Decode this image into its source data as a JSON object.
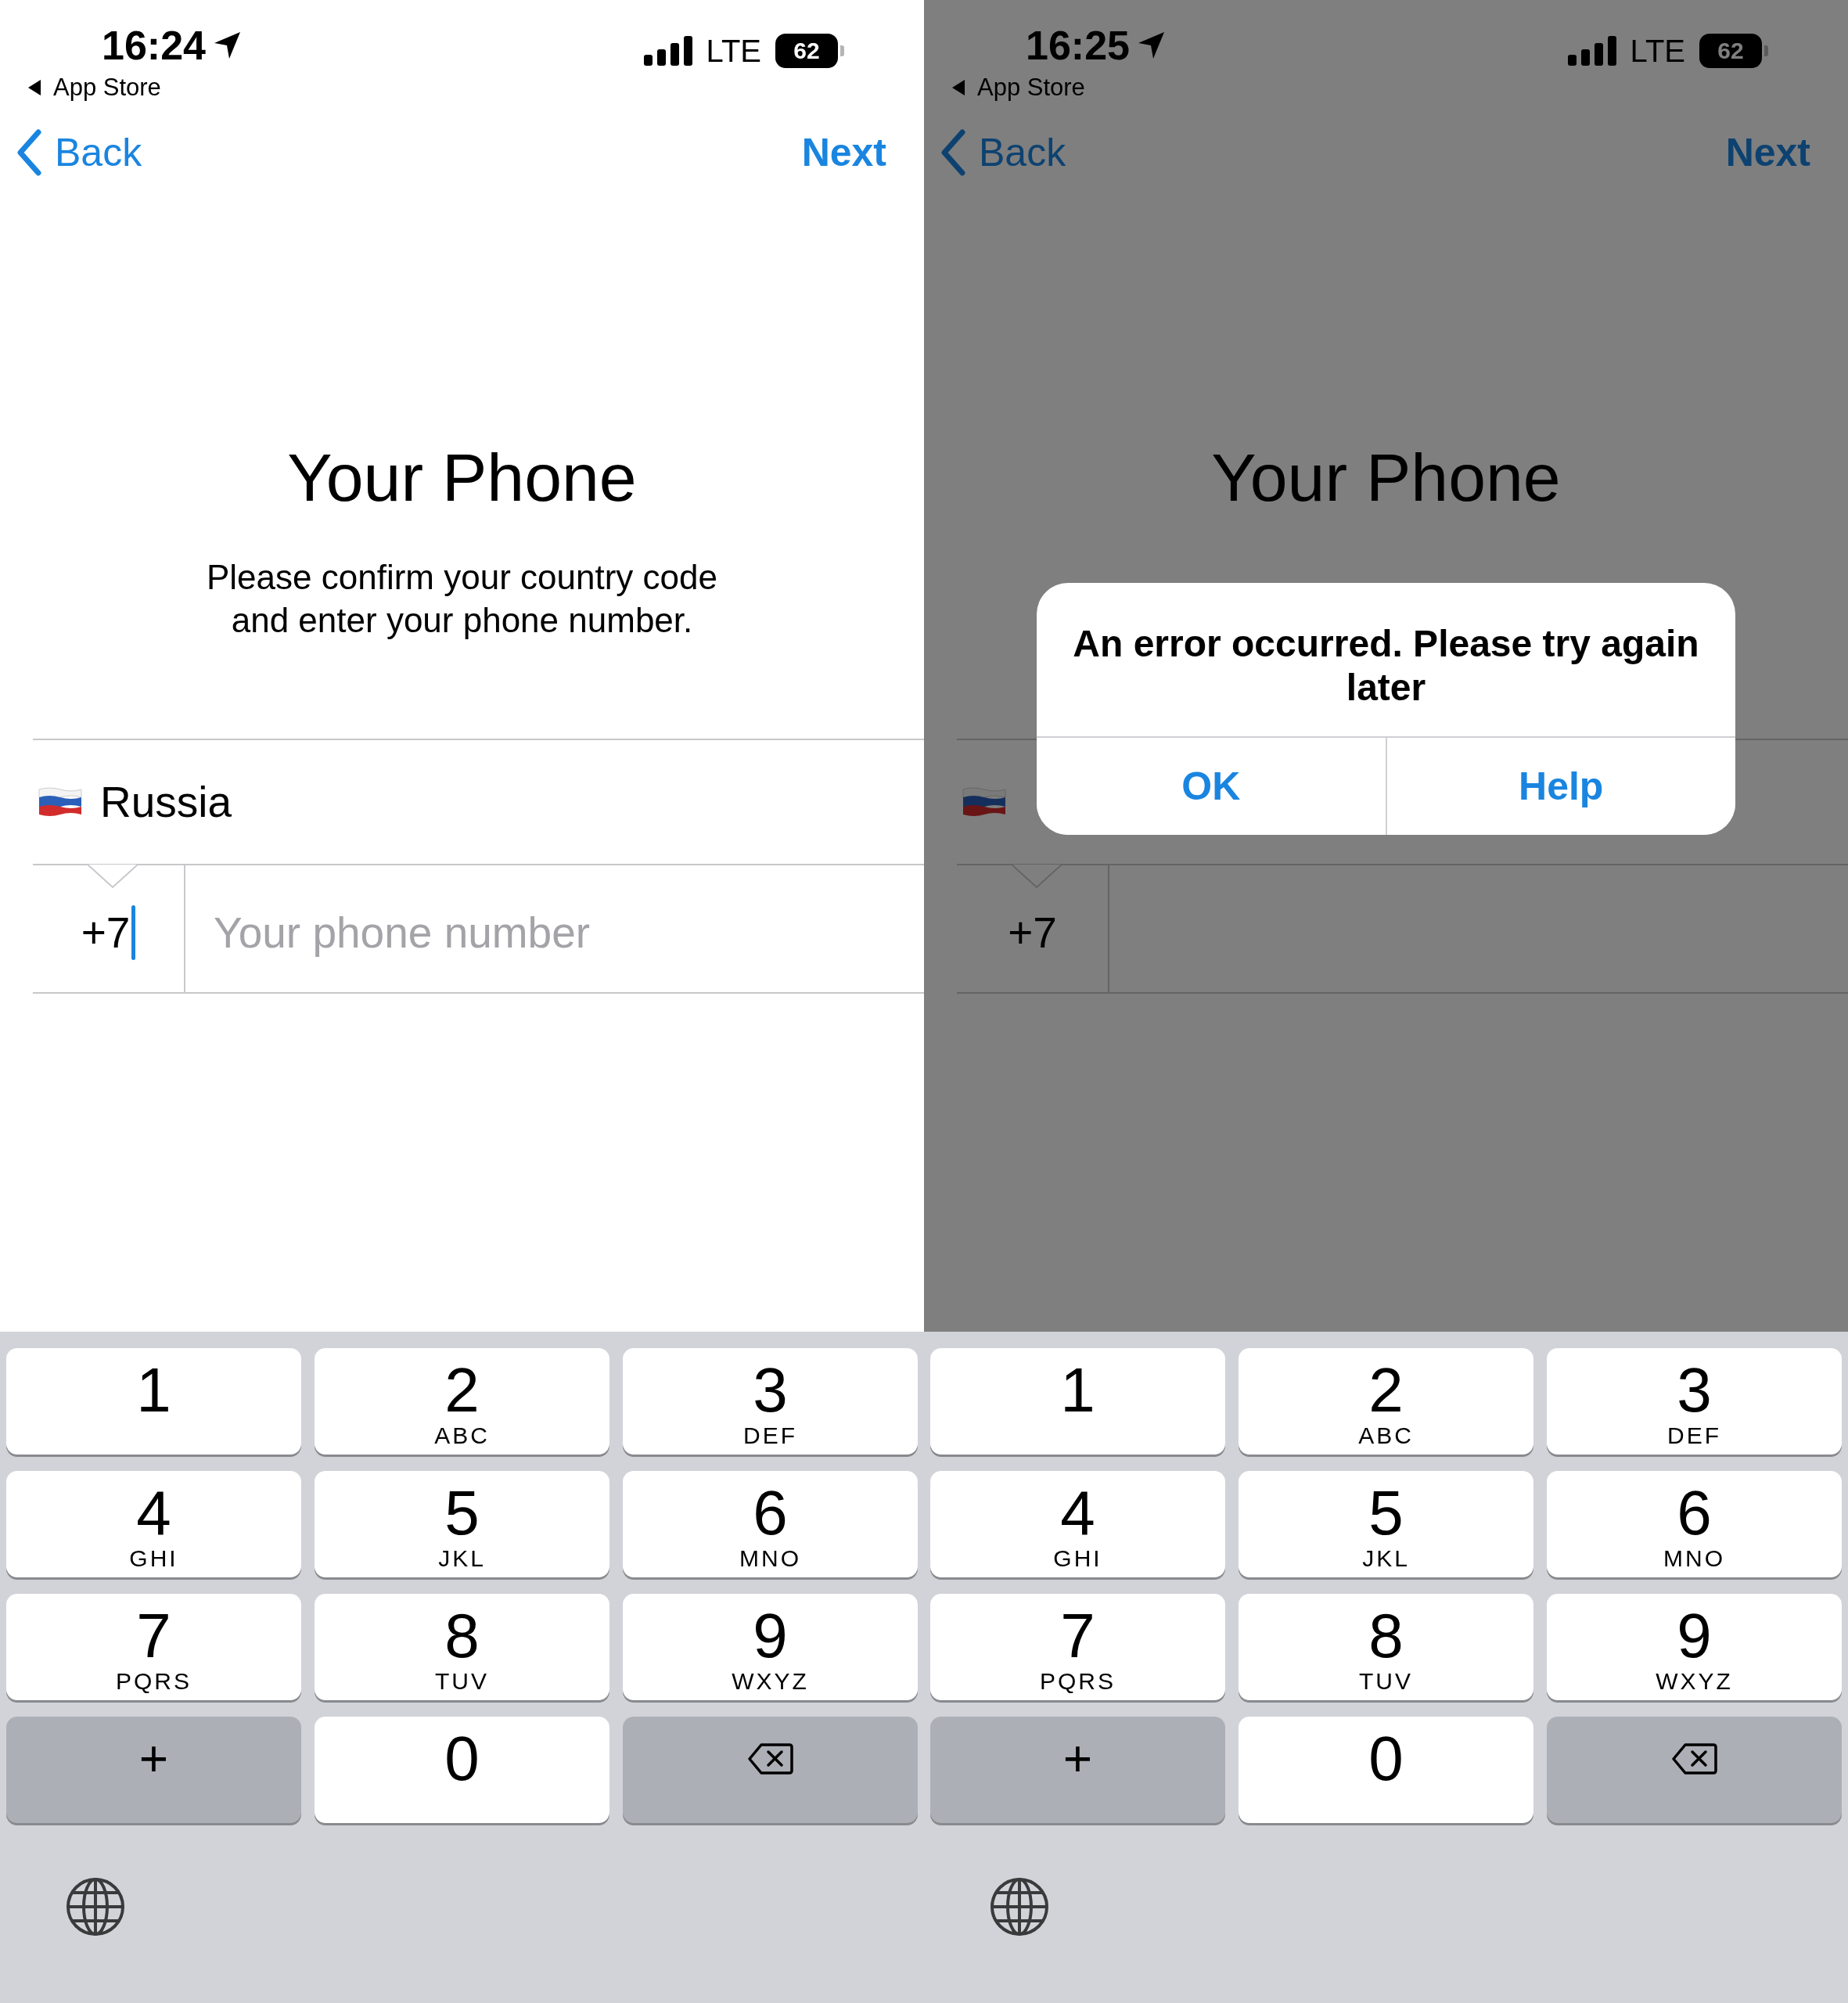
{
  "screens": [
    {
      "status_bar": {
        "time": "16:24",
        "back_app": "App Store",
        "network": "LTE",
        "battery": "62"
      },
      "nav": {
        "back": "Back",
        "next": "Next"
      },
      "title": "Your Phone",
      "subtitle_lines": [
        "Please confirm your country code",
        "and enter your phone number."
      ],
      "country": {
        "name": "Russia"
      },
      "code": "+7",
      "cursor": true,
      "phone": {
        "placeholder": "Your phone number"
      },
      "dimmed": false,
      "keyboard": [
        {
          "kind": "digit",
          "label": "1"
        },
        {
          "kind": "digit",
          "label": "2",
          "letters": "ABC"
        },
        {
          "kind": "digit",
          "label": "3",
          "letters": "DEF"
        },
        {
          "kind": "digit",
          "label": "4",
          "letters": "GHI"
        },
        {
          "kind": "digit",
          "label": "5",
          "letters": "JKL"
        },
        {
          "kind": "digit",
          "label": "6",
          "letters": "MNO"
        },
        {
          "kind": "digit",
          "label": "7",
          "letters": "PQRS"
        },
        {
          "kind": "digit",
          "label": "8",
          "letters": "TUV"
        },
        {
          "kind": "digit",
          "label": "9",
          "letters": "WXYZ"
        },
        {
          "kind": "plus",
          "label": "+"
        },
        {
          "kind": "digit",
          "label": "0"
        },
        {
          "kind": "delete"
        }
      ]
    },
    {
      "status_bar": {
        "time": "16:25",
        "back_app": "App Store",
        "network": "LTE",
        "battery": "62"
      },
      "nav": {
        "back": "Back",
        "next": "Next"
      },
      "title": "Your Phone",
      "code": "+7",
      "cursor": false,
      "dimmed": true,
      "alert": {
        "message": "An error occurred. Please try again later",
        "buttons": [
          "OK",
          "Help"
        ]
      },
      "keyboard": [
        {
          "kind": "digit",
          "label": "1"
        },
        {
          "kind": "digit",
          "label": "2",
          "letters": "ABC"
        },
        {
          "kind": "digit",
          "label": "3",
          "letters": "DEF"
        },
        {
          "kind": "digit",
          "label": "4",
          "letters": "GHI"
        },
        {
          "kind": "digit",
          "label": "5",
          "letters": "JKL"
        },
        {
          "kind": "digit",
          "label": "6",
          "letters": "MNO"
        },
        {
          "kind": "digit",
          "label": "7",
          "letters": "PQRS"
        },
        {
          "kind": "digit",
          "label": "8",
          "letters": "TUV"
        },
        {
          "kind": "digit",
          "label": "9",
          "letters": "WXYZ"
        },
        {
          "kind": "plus",
          "label": "+"
        },
        {
          "kind": "digit",
          "label": "0"
        },
        {
          "kind": "delete"
        }
      ]
    }
  ]
}
